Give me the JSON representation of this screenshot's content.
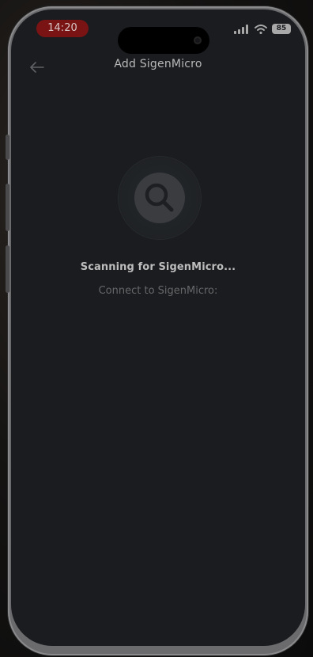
{
  "status_bar": {
    "time": "14:20",
    "battery": "85",
    "icons": [
      "cellular-signal-icon",
      "wifi-icon",
      "battery-icon"
    ]
  },
  "header": {
    "title": "Add SigenMicro",
    "back_icon": "back-arrow-icon"
  },
  "scan": {
    "icon": "search-icon",
    "title": "Scanning for SigenMicro...",
    "subtitle": "Connect to SigenMicro:"
  },
  "colors": {
    "screen_bg": "#1a1c1f",
    "time_pill": "#7a1414",
    "title_text": "#b9b9b9",
    "subtitle_text": "#656769"
  }
}
